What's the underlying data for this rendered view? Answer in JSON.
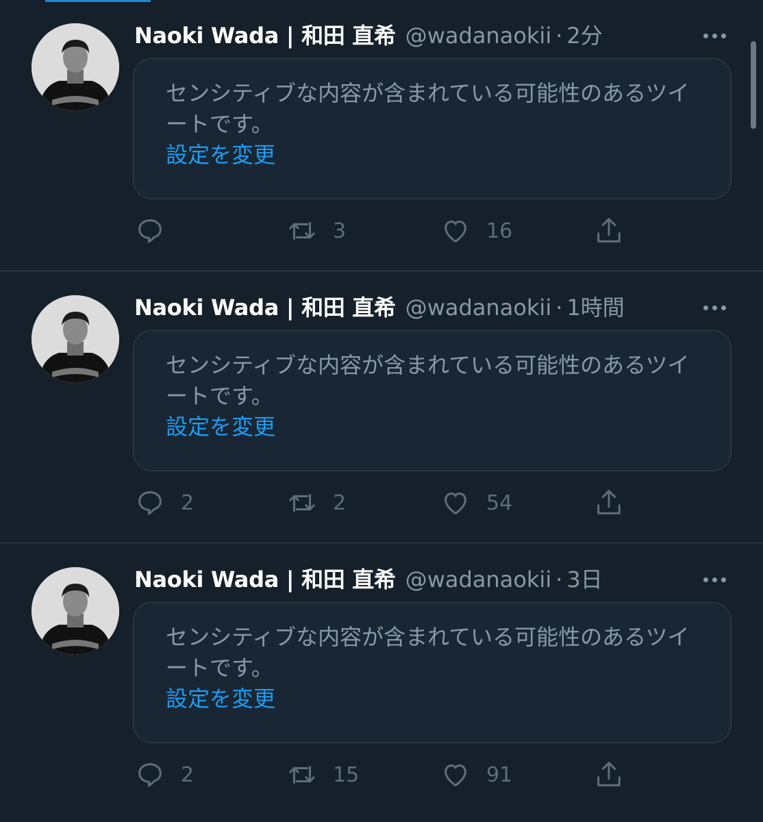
{
  "colors": {
    "background": "#15202b",
    "card": "#192734",
    "border": "#38444d",
    "secondary_text": "#8899a6",
    "link": "#1d9bf0",
    "action_icon": "#5d6d7a"
  },
  "tweets": [
    {
      "name": "Naoki Wada | 和田 直希",
      "handle": "@wadanaokii",
      "separator": "·",
      "time": "2分",
      "notice": "センシティブな内容が含まれている可能性のあるツイートです。",
      "notice_link": "設定を変更",
      "replies": "",
      "retweets": "3",
      "likes": "16",
      "icons": {
        "reply": "reply-icon",
        "retweet": "retweet-icon",
        "like": "heart-icon",
        "share": "share-icon",
        "more": "more-icon"
      }
    },
    {
      "name": "Naoki Wada | 和田 直希",
      "handle": "@wadanaokii",
      "separator": "·",
      "time": "1時間",
      "notice": "センシティブな内容が含まれている可能性のあるツイートです。",
      "notice_link": "設定を変更",
      "replies": "2",
      "retweets": "2",
      "likes": "54",
      "icons": {
        "reply": "reply-icon",
        "retweet": "retweet-icon",
        "like": "heart-icon",
        "share": "share-icon",
        "more": "more-icon"
      }
    },
    {
      "name": "Naoki Wada | 和田 直希",
      "handle": "@wadanaokii",
      "separator": "·",
      "time": "3日",
      "notice": "センシティブな内容が含まれている可能性のあるツイートです。",
      "notice_link": "設定を変更",
      "replies": "2",
      "retweets": "15",
      "likes": "91",
      "icons": {
        "reply": "reply-icon",
        "retweet": "retweet-icon",
        "like": "heart-icon",
        "share": "share-icon",
        "more": "more-icon"
      }
    }
  ]
}
